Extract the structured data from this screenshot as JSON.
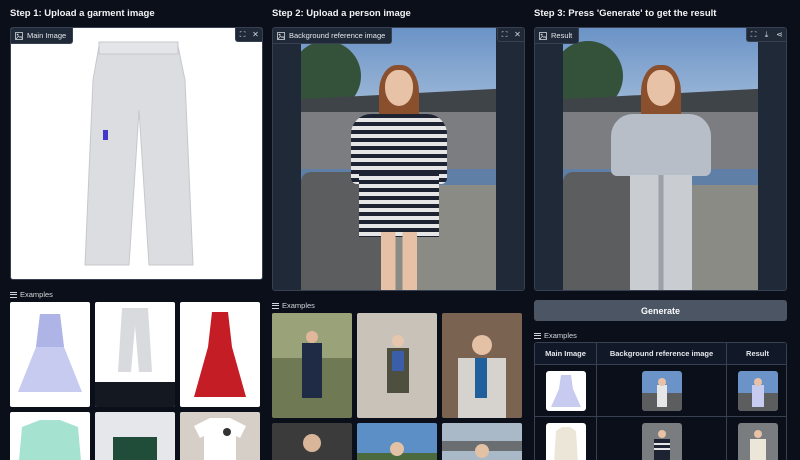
{
  "steps": {
    "step1": "Step 1: Upload a garment image",
    "step2": "Step 2: Upload a person image",
    "step3": "Step 3: Press 'Generate' to get the result"
  },
  "panels": {
    "garment_label": "Main Image",
    "person_label": "Background reference image",
    "result_label": "Result"
  },
  "icons": {
    "image": "image-icon",
    "fullscreen": "fullscreen-icon",
    "close": "close-icon",
    "download": "download-icon",
    "share": "share-icon",
    "examples": "list-icon"
  },
  "examples_label": "Examples",
  "generate_label": "Generate",
  "examples_table": {
    "headers": [
      "Main Image",
      "Background reference image",
      "Result"
    ]
  }
}
